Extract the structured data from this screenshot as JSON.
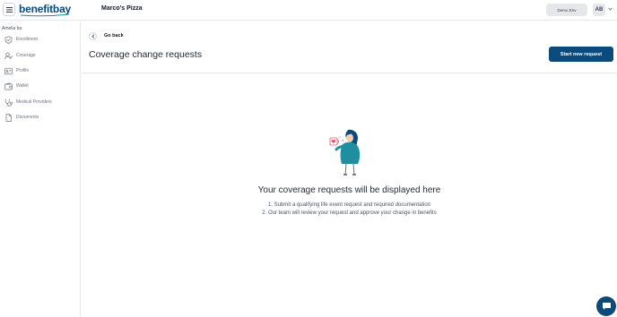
{
  "header": {
    "logo_text": "benefitbay",
    "company": "Marco's Pizza",
    "env_button": "Demo Env",
    "avatar_initials": "AB"
  },
  "sidebar": {
    "user_name": "Amelia ba",
    "items": [
      {
        "label": "Enrollment",
        "icon": "shield-check-icon"
      },
      {
        "label": "Coverage",
        "icon": "user-coverage-icon"
      },
      {
        "label": "Profile",
        "icon": "id-card-icon"
      },
      {
        "label": "Wallet",
        "icon": "wallet-icon"
      },
      {
        "label": "Medical Providers",
        "icon": "stethoscope-icon"
      },
      {
        "label": "Documents",
        "icon": "document-icon"
      }
    ]
  },
  "main": {
    "back_label": "Go back",
    "title": "Coverage change requests",
    "primary_button": "Start new request",
    "empty_state": {
      "title": "Your coverage requests will be displayed here",
      "steps": [
        "1. Submit a qualifying life event request and required documentation",
        "2. Our team will review your request and approve your change in benefits"
      ]
    }
  },
  "colors": {
    "brand": "#0b4a7a",
    "illustration_teal": "#1f8fa0",
    "illustration_pink": "#e0576d"
  }
}
